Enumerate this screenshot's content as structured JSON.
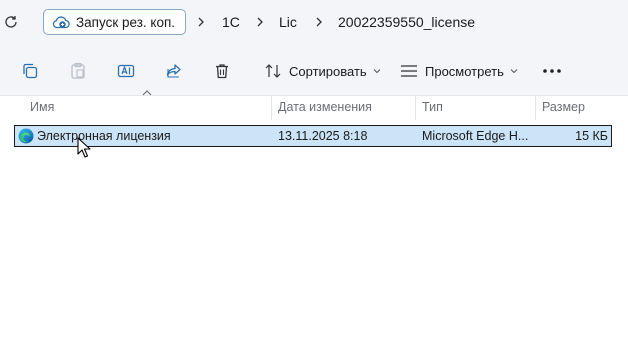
{
  "address_bar": {
    "backup_button_label": "Запуск рез. коп.",
    "breadcrumbs": [
      "1C",
      "Lic",
      "20022359550_license"
    ]
  },
  "toolbar": {
    "sort_label": "Сортировать",
    "view_label": "Просмотреть"
  },
  "columns": {
    "name": "Имя",
    "date": "Дата изменения",
    "type": "Тип",
    "size": "Размер"
  },
  "files": [
    {
      "name": "Электронная лицензия",
      "date": "13.11.2025 8:18",
      "type": "Microsoft Edge H...",
      "size": "15 КБ",
      "selected": true,
      "icon": "edge-icon"
    }
  ],
  "colors": {
    "selection": "#cce4f7",
    "chrome_bg": "#f3f5f9",
    "header_text": "#6b6f76"
  }
}
